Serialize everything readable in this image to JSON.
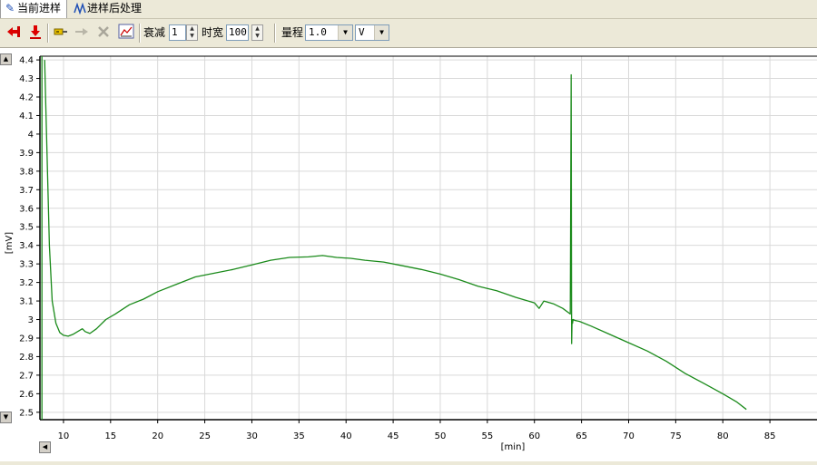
{
  "tabs": [
    {
      "label": "当前进样",
      "icon": "wrench-icon",
      "active": true
    },
    {
      "label": "进样后处理",
      "icon": "peaks-icon",
      "active": false
    }
  ],
  "toolbar": {
    "icons": [
      "arrow-left-red-icon",
      "arrow-down-red-icon",
      "key-icon",
      "pointer-disabled-icon",
      "delete-disabled-icon",
      "chart-icon"
    ],
    "attenuation_label": "衰减",
    "attenuation_value": "1",
    "timewidth_label": "时宽",
    "timewidth_value": "100",
    "range_label": "量程",
    "range_value": "1.0",
    "unit_value": "V"
  },
  "colors": {
    "trace": "#1a8a1a",
    "grid": "#d9d9d9"
  },
  "chart_data": {
    "type": "line",
    "title": "",
    "xlabel": "[min]",
    "ylabel": "[mV]",
    "xlim": [
      7.5,
      90
    ],
    "ylim": [
      2.46,
      4.42
    ],
    "xticks": [
      10,
      15,
      20,
      25,
      30,
      35,
      40,
      45,
      50,
      55,
      60,
      65,
      70,
      75,
      80,
      85
    ],
    "yticks": [
      2.5,
      2.6,
      2.7,
      2.8,
      2.9,
      3,
      3.1,
      3.2,
      3.3,
      3.4,
      3.5,
      3.6,
      3.7,
      3.8,
      3.9,
      4,
      4.1,
      4.2,
      4.3,
      4.4
    ],
    "grid": true,
    "series": [
      {
        "color": "#1a8a1a",
        "x": [
          8.0,
          8.1,
          8.3,
          8.5,
          8.8,
          9.2,
          9.6,
          10.0,
          10.5,
          11.0,
          11.5,
          12.0,
          12.3,
          12.8,
          13.5,
          14.5,
          15.5,
          17.0,
          18.5,
          20.0,
          22.0,
          24.0,
          26.0,
          28.0,
          30.0,
          32.0,
          34.0,
          36.0,
          37.5,
          39.0,
          40.5,
          42.0,
          44.0,
          46.0,
          48.0,
          50.0,
          52.0,
          54.0,
          56.0,
          58.0,
          60.0,
          60.5,
          61.0,
          62.0,
          63.0,
          63.8,
          63.85,
          63.9,
          63.95,
          64.0,
          64.05,
          64.1,
          64.3,
          64.8,
          66.0,
          68.0,
          70.0,
          72.0,
          74.0,
          76.0,
          78.0,
          80.0,
          81.5,
          82.5
        ],
        "y": [
          4.4,
          4.2,
          3.8,
          3.4,
          3.1,
          2.98,
          2.93,
          2.915,
          2.91,
          2.92,
          2.935,
          2.95,
          2.935,
          2.925,
          2.95,
          3.0,
          3.03,
          3.08,
          3.11,
          3.15,
          3.19,
          3.23,
          3.25,
          3.27,
          3.295,
          3.32,
          3.335,
          3.338,
          3.345,
          3.335,
          3.33,
          3.32,
          3.31,
          3.29,
          3.27,
          3.245,
          3.215,
          3.18,
          3.155,
          3.12,
          3.09,
          3.06,
          3.1,
          3.085,
          3.06,
          3.03,
          3.65,
          4.32,
          2.87,
          3.0,
          2.98,
          3.0,
          2.995,
          2.99,
          2.965,
          2.92,
          2.875,
          2.83,
          2.775,
          2.71,
          2.655,
          2.6,
          2.555,
          2.515
        ]
      }
    ]
  }
}
